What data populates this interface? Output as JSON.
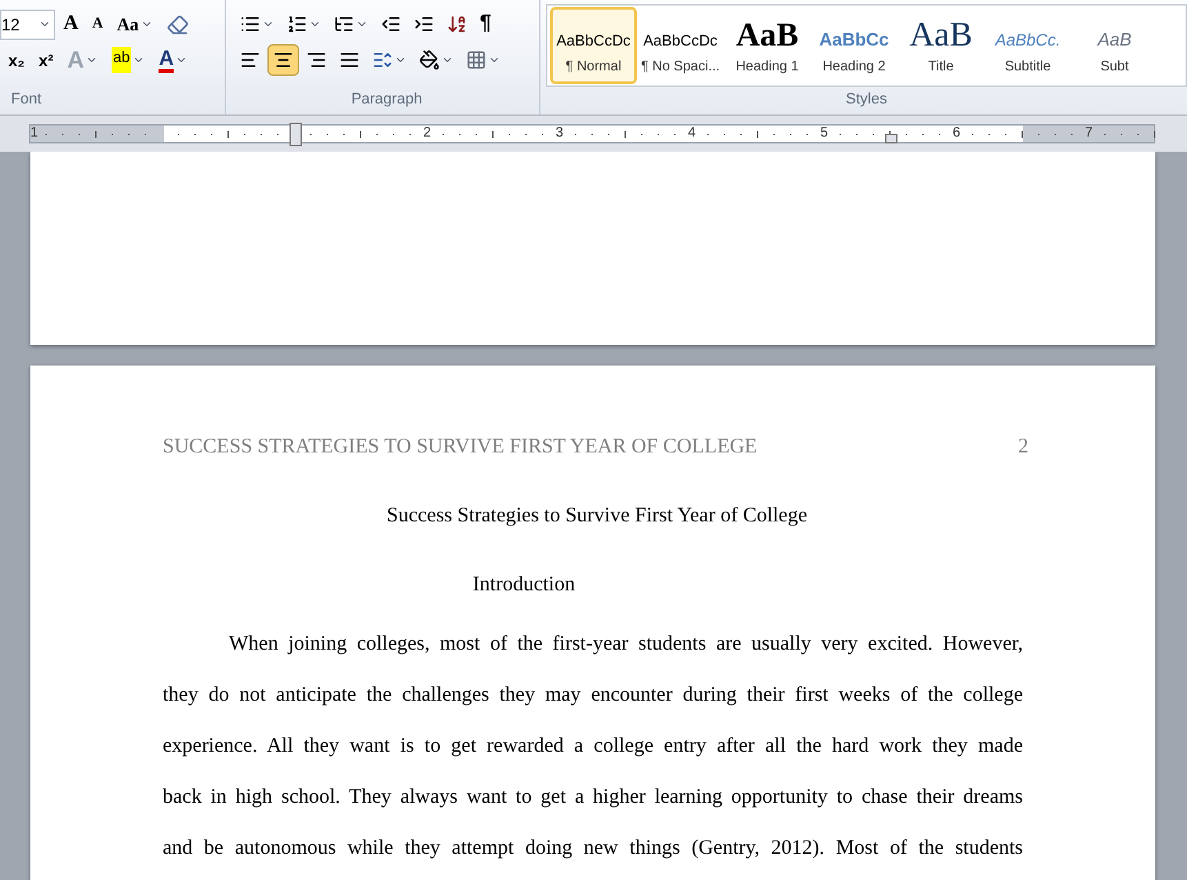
{
  "ribbon": {
    "font": {
      "size": "12",
      "grow": "A",
      "shrink": "A",
      "change_case": "Aa",
      "subscript": "x₂",
      "superscript": "x²",
      "text_effects": "A",
      "highlight": "ab",
      "font_color": "A",
      "label": "Font"
    },
    "paragraph": {
      "pilcrow": "¶",
      "alignments": [
        {
          "kind": "left",
          "selected": false
        },
        {
          "kind": "center",
          "selected": true
        },
        {
          "kind": "right",
          "selected": false
        },
        {
          "kind": "justify",
          "selected": false
        }
      ],
      "label": "Paragraph"
    },
    "styles": {
      "items": [
        {
          "preview": "AaBbCcDc",
          "label": "¶ Normal",
          "kind": "normal",
          "selected": true
        },
        {
          "preview": "AaBbCcDc",
          "label": "¶ No Spaci...",
          "kind": "normal",
          "selected": false
        },
        {
          "preview": "AaB",
          "label": "Heading 1",
          "kind": "heading1",
          "selected": false
        },
        {
          "preview": "AaBbCc",
          "label": "Heading 2",
          "kind": "heading2",
          "selected": false
        },
        {
          "preview": "AaB",
          "label": "Title",
          "kind": "title",
          "selected": false
        },
        {
          "preview": "AaBbCc.",
          "label": "Subtitle",
          "kind": "subtitle",
          "selected": false
        },
        {
          "preview": "AaB",
          "label": "Subt",
          "kind": "subtle",
          "selected": false
        }
      ],
      "label": "Styles"
    }
  },
  "ruler": {
    "numbers": [
      "1",
      "2",
      "3",
      "4",
      "5",
      "6",
      "7"
    ]
  },
  "page": {
    "header": "SUCCESS STRATEGIES TO SURVIVE FIRST YEAR OF COLLEGE",
    "page_number": "2",
    "title": "Success Strategies to Survive First Year of College",
    "heading": "Introduction",
    "lines": [
      "When joining colleges, most of the first-year students are usually very excited. However,",
      "they do not anticipate the challenges they may encounter during their first weeks of the college",
      "experience. All they want is to get rewarded a college entry after all the hard work they made",
      "back in high school. They always want to get a higher learning opportunity to chase their dreams",
      "and be autonomous while they attempt doing new things (Gentry, 2012). Most of the students"
    ]
  }
}
